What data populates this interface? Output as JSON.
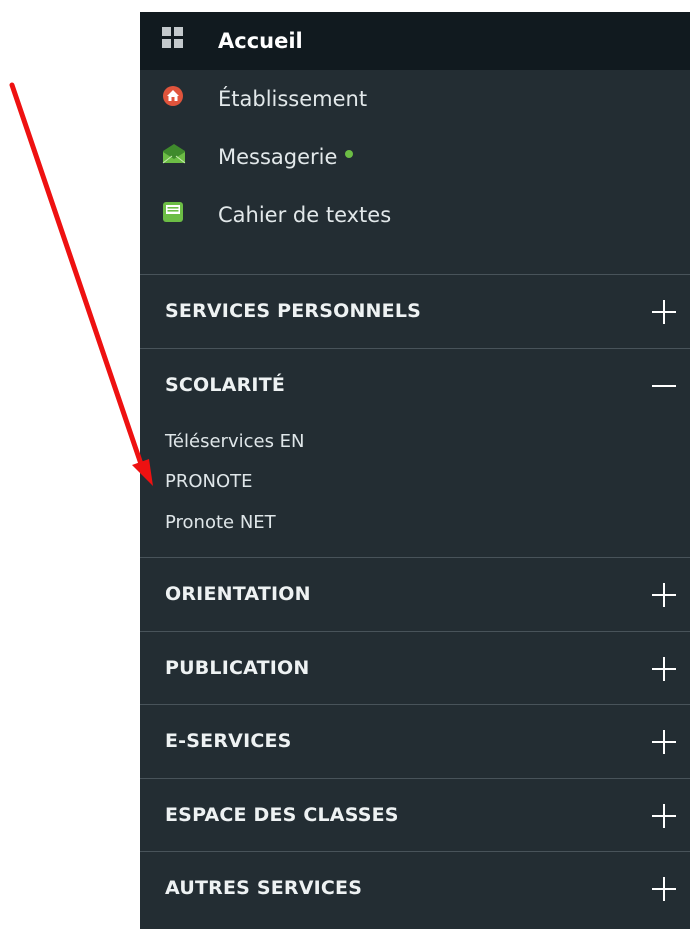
{
  "nav": {
    "items": [
      {
        "label": "Accueil",
        "icon": "grid-icon"
      },
      {
        "label": "Établissement",
        "icon": "home-icon"
      },
      {
        "label": "Messagerie",
        "icon": "envelope-icon",
        "online": true
      },
      {
        "label": "Cahier de textes",
        "icon": "notebook-icon"
      }
    ]
  },
  "sections": [
    {
      "title": "SERVICES PERSONNELS",
      "expanded": false
    },
    {
      "title": "SCOLARITÉ",
      "expanded": true,
      "links": [
        "Téléservices EN",
        "PRONOTE",
        "Pronote NET"
      ]
    },
    {
      "title": "ORIENTATION",
      "expanded": false
    },
    {
      "title": "PUBLICATION",
      "expanded": false
    },
    {
      "title": "E-SERVICES",
      "expanded": false
    },
    {
      "title": "ESPACE DES CLASSES",
      "expanded": false
    },
    {
      "title": "AUTRES SERVICES",
      "expanded": false
    }
  ],
  "colors": {
    "sidebar_bg": "#232d33",
    "header_bg": "#111a1f",
    "online_dot": "#6cbd45",
    "arrow": "#ee1111"
  }
}
